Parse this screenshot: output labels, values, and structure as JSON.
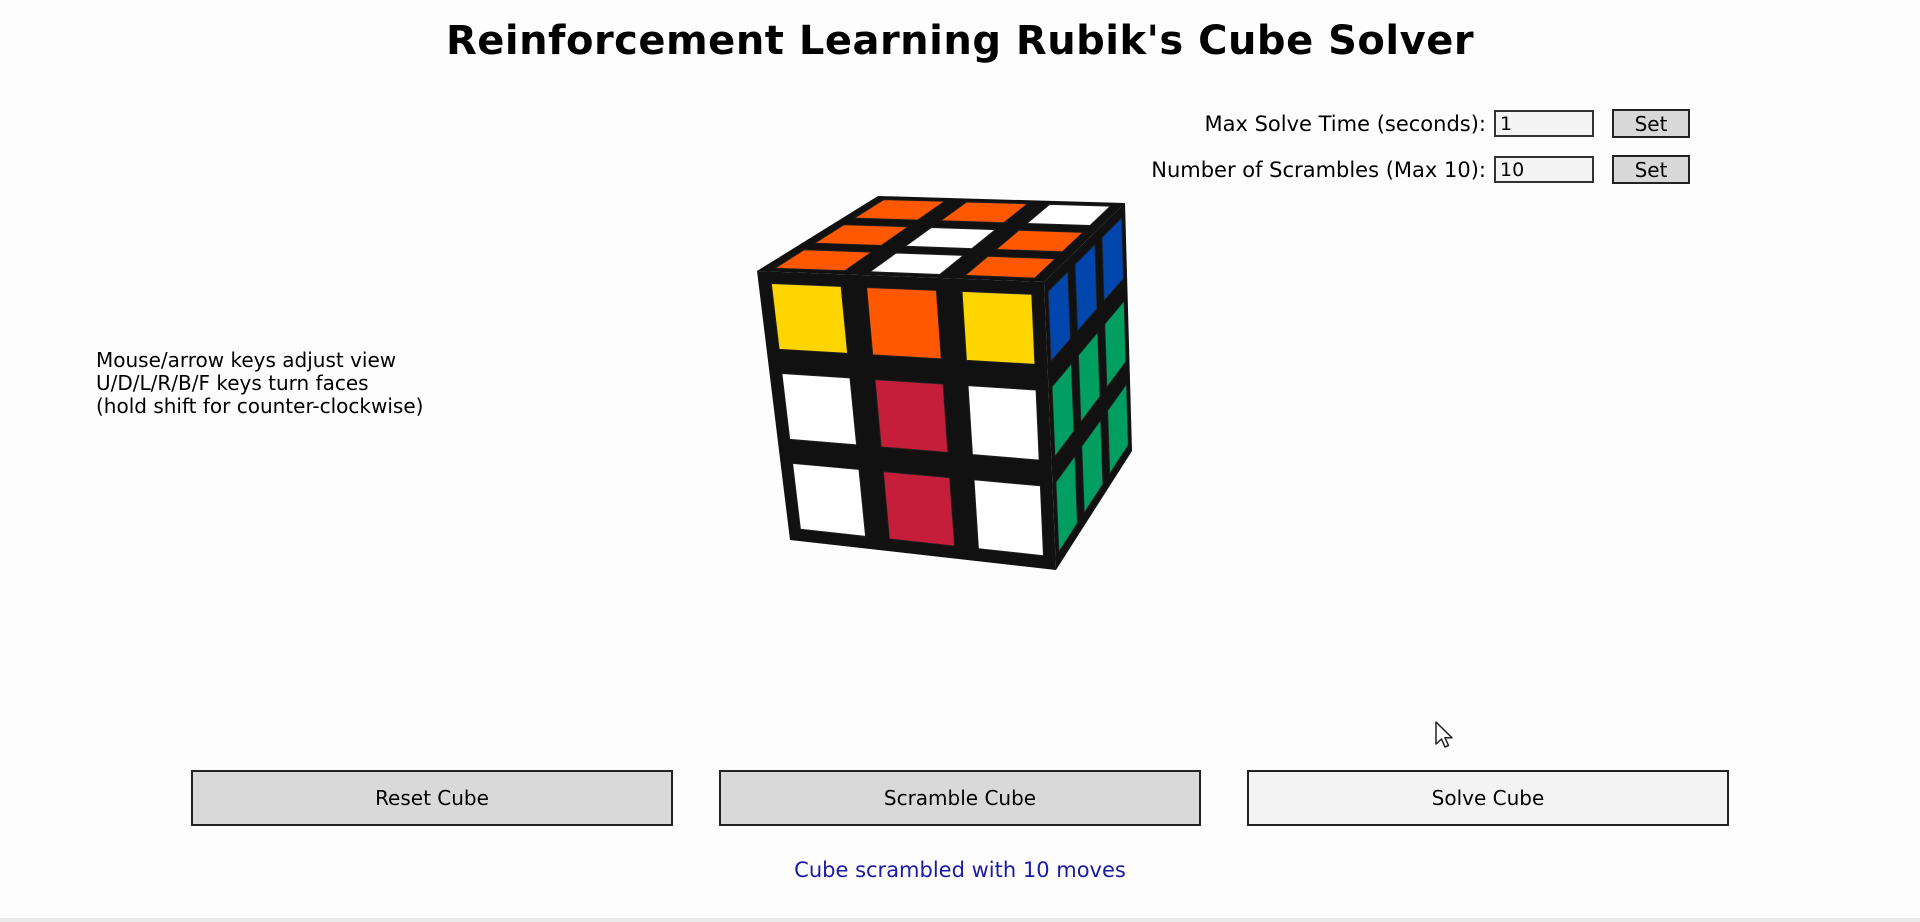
{
  "title": "Reinforcement Learning Rubik's Cube Solver",
  "settings": {
    "max_time": {
      "label": "Max Solve Time (seconds):",
      "value": "1",
      "button": "Set"
    },
    "scrambles": {
      "label": "Number of Scrambles (Max 10):",
      "value": "10",
      "button": "Set"
    }
  },
  "instructions": [
    "Mouse/arrow keys adjust view",
    "U/D/L/R/B/F keys turn faces",
    "(hold shift for counter-clockwise)"
  ],
  "cube": {
    "colors": {
      "Y": "#ffd500",
      "O": "#ff5800",
      "W": "#ffffff",
      "R": "#c41e3a",
      "B": "#0046ad",
      "G": "#009e60"
    },
    "top_face": [
      [
        "O",
        "O",
        "W"
      ],
      [
        "O",
        "W",
        "O"
      ],
      [
        "O",
        "W",
        "O"
      ]
    ],
    "front_face": [
      [
        "Y",
        "O",
        "Y"
      ],
      [
        "W",
        "R",
        "W"
      ],
      [
        "W",
        "R",
        "W"
      ]
    ],
    "right_face": [
      [
        "B",
        "B",
        "B"
      ],
      [
        "G",
        "G",
        "G"
      ],
      [
        "G",
        "G",
        "G"
      ]
    ]
  },
  "buttons": {
    "reset": "Reset Cube",
    "scramble": "Scramble Cube",
    "solve": "Solve Cube"
  },
  "status": "Cube scrambled with 10 moves"
}
